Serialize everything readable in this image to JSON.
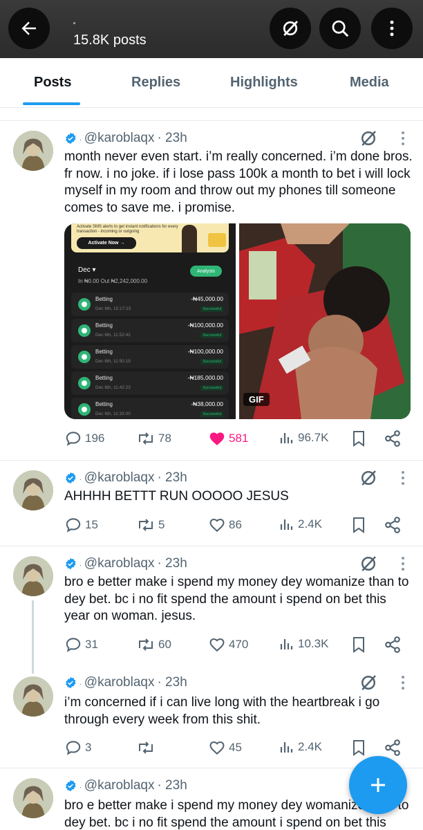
{
  "header": {
    "title": "15.8K posts",
    "icons": [
      "back-arrow-icon",
      "noun-slash-icon",
      "search-icon",
      "more-vertical-icon"
    ]
  },
  "tabs": [
    {
      "label": "Posts",
      "active": true
    },
    {
      "label": "Replies",
      "active": false
    },
    {
      "label": "Highlights",
      "active": false
    },
    {
      "label": "Media",
      "active": false
    }
  ],
  "colors": {
    "accent": "#1d9bf0",
    "like": "#f91880",
    "muted": "#536471",
    "text": "#0f1419"
  },
  "posts": [
    {
      "handle": "@karoblaqx",
      "time": "· 23h",
      "text": "month never even start. i’m really concerned. i’m done bros. fr now. i no joke. if i lose pass 100k a month to bet i will lock myself in my room and throw out my phones till someone comes to save me. i promise.",
      "replies": "196",
      "reposts": "78",
      "likes": "581",
      "liked": true,
      "views": "96.7K"
    },
    {
      "handle": "@karoblaqx",
      "time": "· 23h",
      "text": "AHHHH BETTT RUN OOOOO JESUS",
      "replies": "15",
      "reposts": "5",
      "likes": "86",
      "liked": false,
      "views": "2.4K"
    },
    {
      "handle": "@karoblaqx",
      "time": "· 23h",
      "text": "bro e better make i spend my money dey womanize than to dey bet. bc i no fit spend the amount i spend on bet this year on woman. jesus.",
      "replies": "31",
      "reposts": "60",
      "likes": "470",
      "liked": false,
      "views": "10.3K"
    },
    {
      "handle": "@karoblaqx",
      "time": "· 23h",
      "text": "i’m concerned if i can live long with the heartbreak i go through every week from this shit.",
      "replies": "3",
      "reposts": "",
      "likes": "45",
      "liked": false,
      "views": "2.4K"
    },
    {
      "handle": "@karoblaqx",
      "time": "· 23h",
      "text": "bro e better make i spend my money dey womanize than to dey bet. bc i no fit spend the amount i spend on bet this"
    }
  ],
  "media": {
    "screenshot": {
      "notif_text": "Activate SMS alerts to get instant notifications for every transaction - incoming or outgoing",
      "notif_button": "Activate Now →",
      "month": "Dec ▾",
      "in_out": "In ₦0.00   Out ₦2,242,000.00",
      "analysis": "Analysis",
      "transactions": [
        {
          "name": "Betting",
          "date": "Dec 6th, 15:17:23",
          "amount": "-₦45,000.00",
          "status": "Successful"
        },
        {
          "name": "Betting",
          "date": "Dec 6th, 11:52:42",
          "amount": "-₦100,000.00",
          "status": "Successful"
        },
        {
          "name": "Betting",
          "date": "Dec 6th, 11:50:19",
          "amount": "-₦100,000.00",
          "status": "Successful"
        },
        {
          "name": "Betting",
          "date": "Dec 6th, 11:42:23",
          "amount": "-₦185,000.00",
          "status": "Successful"
        },
        {
          "name": "Betting",
          "date": "Dec 6th, 11:33:00",
          "amount": "-₦38,000.00",
          "status": "Successful"
        }
      ]
    },
    "gif_label": "GIF"
  },
  "fab": {
    "icon": "plus-icon"
  }
}
